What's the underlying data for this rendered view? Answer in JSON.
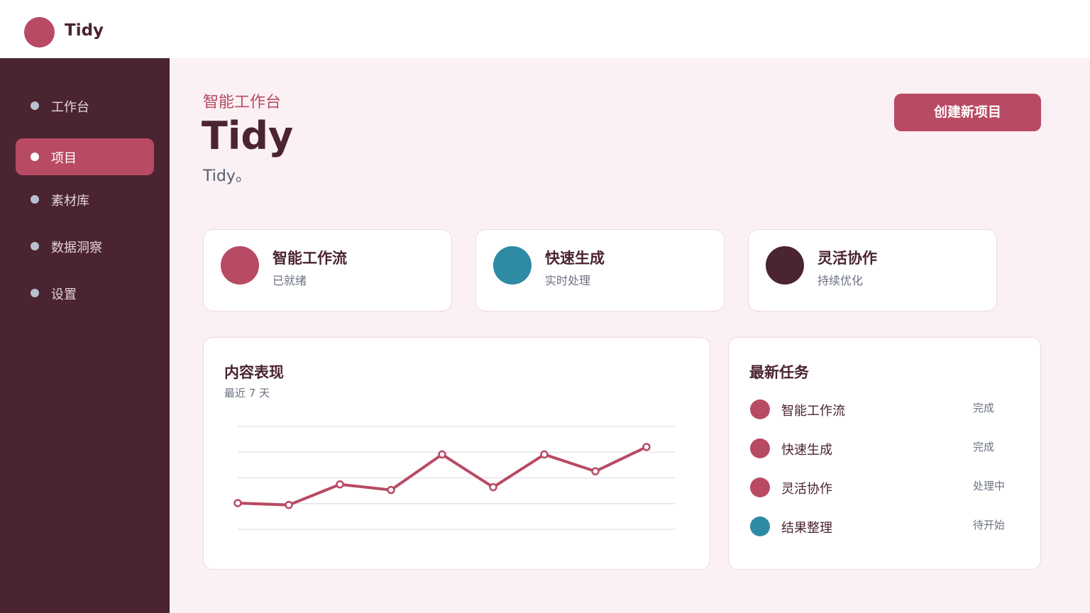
{
  "app": {
    "name": "Tidy",
    "accent": "#b84a63",
    "teal": "#2f8aa3",
    "dark": "#4a2430"
  },
  "sidebar": {
    "items": [
      {
        "label": "工作台",
        "icon": "dot-icon",
        "active": false
      },
      {
        "label": "项目",
        "icon": "dot-icon",
        "active": true
      },
      {
        "label": "素材库",
        "icon": "dot-icon",
        "active": false
      },
      {
        "label": "数据洞察",
        "icon": "dot-icon",
        "active": false
      },
      {
        "label": "设置",
        "icon": "dot-icon",
        "active": false
      }
    ]
  },
  "header": {
    "subtitle": "智能工作台",
    "title": "Tidy",
    "description": "Tidy。",
    "create_button": "创建新项目"
  },
  "features": [
    {
      "title": "智能工作流",
      "desc": "已就绪",
      "color": "#b84a63"
    },
    {
      "title": "快速生成",
      "desc": "实时处理",
      "color": "#2f8aa3"
    },
    {
      "title": "灵活协作",
      "desc": "持续优化",
      "color": "#4a2430"
    }
  ],
  "chart": {
    "title": "内容表现",
    "subtitle": "最近 7 天"
  },
  "chart_data": {
    "type": "line",
    "values": [
      28,
      26,
      48,
      42,
      80,
      45,
      80,
      62,
      88
    ],
    "ylim": [
      0,
      110
    ],
    "grid": true,
    "color": "#b84a63"
  },
  "tasks": {
    "title": "最新任务",
    "items": [
      {
        "name": "智能工作流",
        "status": "完成",
        "color": "#b84a63"
      },
      {
        "name": "快速生成",
        "status": "完成",
        "color": "#b84a63"
      },
      {
        "name": "灵活协作",
        "status": "处理中",
        "color": "#b84a63"
      },
      {
        "name": "结果整理",
        "status": "待开始",
        "color": "#2f8aa3"
      }
    ]
  }
}
